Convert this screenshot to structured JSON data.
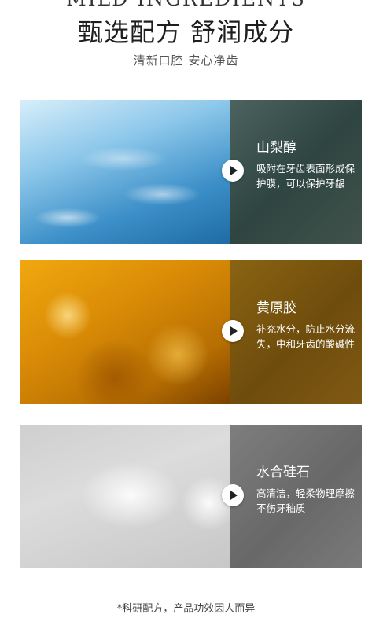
{
  "header": {
    "english_title": "MILD INGREDIENTS",
    "title": "甄选配方 舒润成分",
    "subtitle": "清新口腔 安心净齿"
  },
  "ingredients": [
    {
      "name": "山梨醇",
      "description": "吸附在牙齿表面形成保护膜，可以保护牙龈",
      "image": "lab-petri-dishes",
      "accent": "#3c8fc8"
    },
    {
      "name": "黄原胶",
      "description": "补充水分，防止水分流失，中和牙齿的酸碱性",
      "image": "golden-gel-bubbles",
      "accent": "#d98b06"
    },
    {
      "name": "水合硅石",
      "description": "高清洁，轻柔物理摩擦不伤牙釉质",
      "image": "silica-powder-gel",
      "accent": "#7e7e7e"
    }
  ],
  "footnote": "*科研配方，产品功效因人而异",
  "icons": {
    "play": "play-icon"
  }
}
